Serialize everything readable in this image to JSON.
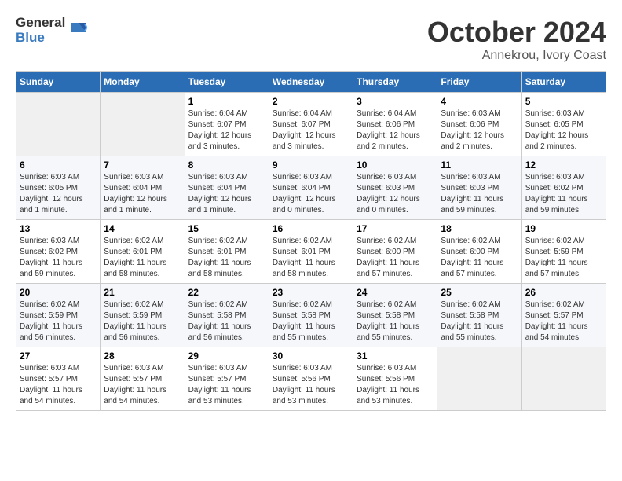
{
  "logo": {
    "general": "General",
    "blue": "Blue"
  },
  "header": {
    "month": "October 2024",
    "location": "Annekrou, Ivory Coast"
  },
  "weekdays": [
    "Sunday",
    "Monday",
    "Tuesday",
    "Wednesday",
    "Thursday",
    "Friday",
    "Saturday"
  ],
  "weeks": [
    [
      {
        "day": "",
        "empty": true
      },
      {
        "day": "",
        "empty": true
      },
      {
        "day": "1",
        "sunrise": "6:04 AM",
        "sunset": "6:07 PM",
        "daylight": "12 hours and 3 minutes."
      },
      {
        "day": "2",
        "sunrise": "6:04 AM",
        "sunset": "6:07 PM",
        "daylight": "12 hours and 3 minutes."
      },
      {
        "day": "3",
        "sunrise": "6:04 AM",
        "sunset": "6:06 PM",
        "daylight": "12 hours and 2 minutes."
      },
      {
        "day": "4",
        "sunrise": "6:03 AM",
        "sunset": "6:06 PM",
        "daylight": "12 hours and 2 minutes."
      },
      {
        "day": "5",
        "sunrise": "6:03 AM",
        "sunset": "6:05 PM",
        "daylight": "12 hours and 2 minutes."
      }
    ],
    [
      {
        "day": "6",
        "sunrise": "6:03 AM",
        "sunset": "6:05 PM",
        "daylight": "12 hours and 1 minute."
      },
      {
        "day": "7",
        "sunrise": "6:03 AM",
        "sunset": "6:04 PM",
        "daylight": "12 hours and 1 minute."
      },
      {
        "day": "8",
        "sunrise": "6:03 AM",
        "sunset": "6:04 PM",
        "daylight": "12 hours and 1 minute."
      },
      {
        "day": "9",
        "sunrise": "6:03 AM",
        "sunset": "6:04 PM",
        "daylight": "12 hours and 0 minutes."
      },
      {
        "day": "10",
        "sunrise": "6:03 AM",
        "sunset": "6:03 PM",
        "daylight": "12 hours and 0 minutes."
      },
      {
        "day": "11",
        "sunrise": "6:03 AM",
        "sunset": "6:03 PM",
        "daylight": "11 hours and 59 minutes."
      },
      {
        "day": "12",
        "sunrise": "6:03 AM",
        "sunset": "6:02 PM",
        "daylight": "11 hours and 59 minutes."
      }
    ],
    [
      {
        "day": "13",
        "sunrise": "6:03 AM",
        "sunset": "6:02 PM",
        "daylight": "11 hours and 59 minutes."
      },
      {
        "day": "14",
        "sunrise": "6:02 AM",
        "sunset": "6:01 PM",
        "daylight": "11 hours and 58 minutes."
      },
      {
        "day": "15",
        "sunrise": "6:02 AM",
        "sunset": "6:01 PM",
        "daylight": "11 hours and 58 minutes."
      },
      {
        "day": "16",
        "sunrise": "6:02 AM",
        "sunset": "6:01 PM",
        "daylight": "11 hours and 58 minutes."
      },
      {
        "day": "17",
        "sunrise": "6:02 AM",
        "sunset": "6:00 PM",
        "daylight": "11 hours and 57 minutes."
      },
      {
        "day": "18",
        "sunrise": "6:02 AM",
        "sunset": "6:00 PM",
        "daylight": "11 hours and 57 minutes."
      },
      {
        "day": "19",
        "sunrise": "6:02 AM",
        "sunset": "5:59 PM",
        "daylight": "11 hours and 57 minutes."
      }
    ],
    [
      {
        "day": "20",
        "sunrise": "6:02 AM",
        "sunset": "5:59 PM",
        "daylight": "11 hours and 56 minutes."
      },
      {
        "day": "21",
        "sunrise": "6:02 AM",
        "sunset": "5:59 PM",
        "daylight": "11 hours and 56 minutes."
      },
      {
        "day": "22",
        "sunrise": "6:02 AM",
        "sunset": "5:58 PM",
        "daylight": "11 hours and 56 minutes."
      },
      {
        "day": "23",
        "sunrise": "6:02 AM",
        "sunset": "5:58 PM",
        "daylight": "11 hours and 55 minutes."
      },
      {
        "day": "24",
        "sunrise": "6:02 AM",
        "sunset": "5:58 PM",
        "daylight": "11 hours and 55 minutes."
      },
      {
        "day": "25",
        "sunrise": "6:02 AM",
        "sunset": "5:58 PM",
        "daylight": "11 hours and 55 minutes."
      },
      {
        "day": "26",
        "sunrise": "6:02 AM",
        "sunset": "5:57 PM",
        "daylight": "11 hours and 54 minutes."
      }
    ],
    [
      {
        "day": "27",
        "sunrise": "6:03 AM",
        "sunset": "5:57 PM",
        "daylight": "11 hours and 54 minutes."
      },
      {
        "day": "28",
        "sunrise": "6:03 AM",
        "sunset": "5:57 PM",
        "daylight": "11 hours and 54 minutes."
      },
      {
        "day": "29",
        "sunrise": "6:03 AM",
        "sunset": "5:57 PM",
        "daylight": "11 hours and 53 minutes."
      },
      {
        "day": "30",
        "sunrise": "6:03 AM",
        "sunset": "5:56 PM",
        "daylight": "11 hours and 53 minutes."
      },
      {
        "day": "31",
        "sunrise": "6:03 AM",
        "sunset": "5:56 PM",
        "daylight": "11 hours and 53 minutes."
      },
      {
        "day": "",
        "empty": true
      },
      {
        "day": "",
        "empty": true
      }
    ]
  ],
  "labels": {
    "sunrise": "Sunrise:",
    "sunset": "Sunset:",
    "daylight": "Daylight:"
  }
}
